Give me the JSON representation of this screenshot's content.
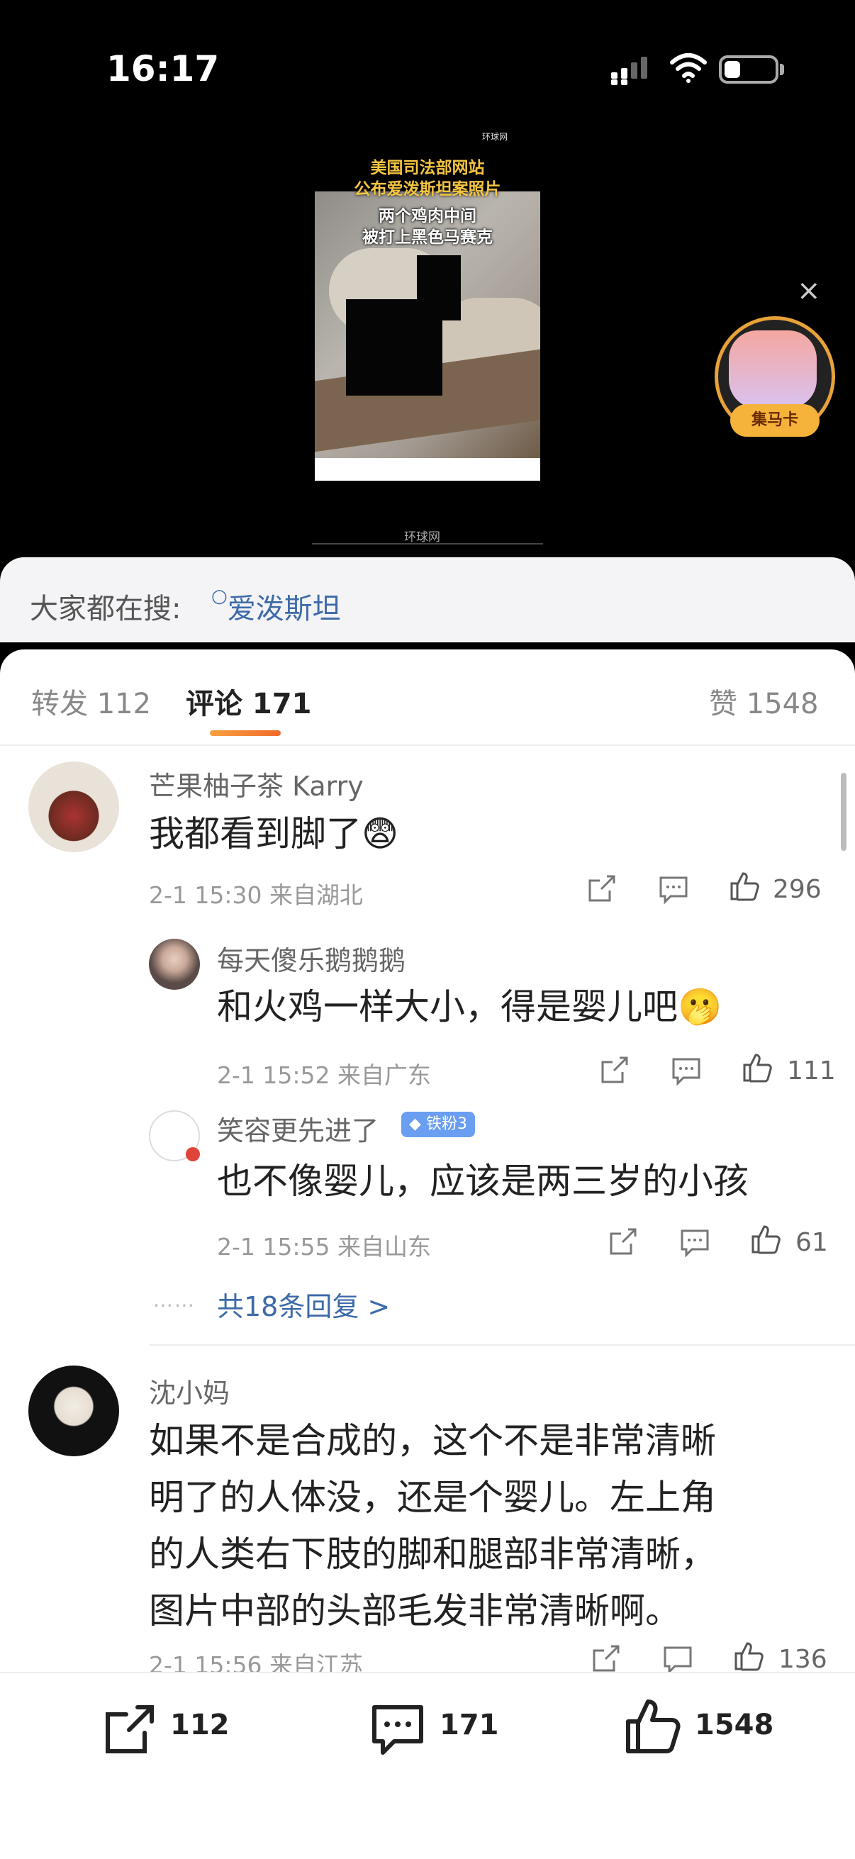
{
  "status": {
    "time": "16:17"
  },
  "video": {
    "title_lines": [
      "美国司法部网站",
      "公布爱泼斯坦案照片"
    ],
    "subtitle_lines": [
      "两个鸡肉中间",
      "被打上黑色马赛克"
    ],
    "watermark": "环球网",
    "bottom_label": "环球网",
    "collect_label": "集马卡",
    "close": "×"
  },
  "search": {
    "label": "大家都在搜:",
    "keyword": "爱泼斯坦"
  },
  "tabs": {
    "forward": "转发 112",
    "comment": "评论 171",
    "likes": "赞 1548"
  },
  "comments": [
    {
      "name": "芒果柚子茶 Karry",
      "text": "我都看到脚了😨",
      "meta": "2-1 15:30  来自湖北",
      "likes": "296",
      "replies": [
        {
          "name": "每天傻乐鹅鹅鹅",
          "text": "和火鸡一样大小，得是婴儿吧🫢",
          "meta": "2-1 15:52  来自广东",
          "likes": "111"
        },
        {
          "name": "笑容更先进了",
          "badge": "铁粉3",
          "text": "也不像婴儿，应该是两三岁的小孩",
          "meta": "2-1 15:55  来自山东",
          "likes": "61"
        }
      ],
      "more_replies": "共18条回复 >"
    },
    {
      "name": "沈小妈",
      "text_lines": [
        "如果不是合成的，这个不是非常清晰",
        "明了的人体没，还是个婴儿。左上角",
        "的人类右下肢的脚和腿部非常清晰，",
        "图片中部的头部毛发非常清晰啊。"
      ],
      "meta": "2-1 15:56  来自江苏",
      "likes": "136"
    }
  ],
  "bottom": {
    "forward": "112",
    "comment": "171",
    "like": "1548"
  }
}
